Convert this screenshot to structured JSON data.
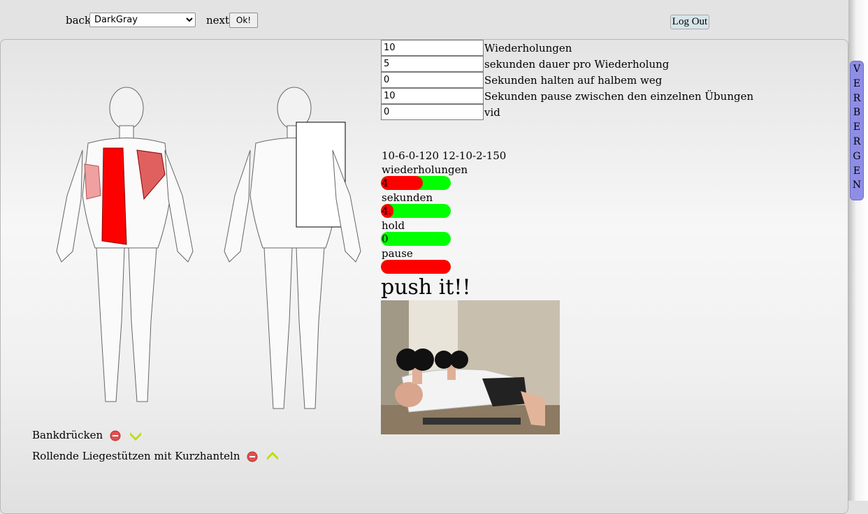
{
  "nav": {
    "back_label": "back",
    "theme_selected": "DarkGray",
    "next_label": "next",
    "ok_label": "Ok!",
    "logout_label": "Log Out"
  },
  "settings": [
    {
      "value": "10",
      "label": " Wiederholungen"
    },
    {
      "value": "5",
      "label": "sekunden dauer pro Wiederholung"
    },
    {
      "value": "0",
      "label": "Sekunden halten auf halbem weg"
    },
    {
      "value": "10",
      "label": "Sekunden pause zwischen den einzelnen Übungen"
    },
    {
      "value": "0",
      "label": "vid"
    }
  ],
  "program": {
    "code": "10-6-0-120 12-10-2-150"
  },
  "bars": [
    {
      "label": "wiederholungen",
      "value": "4",
      "fraction": 0.6
    },
    {
      "label": "sekunden",
      "value": "4.",
      "fraction": 0.18
    },
    {
      "label": "hold",
      "value": "0",
      "fraction": 0.0
    },
    {
      "label": "pause",
      "value": "",
      "fraction": 1.0
    }
  ],
  "status": {
    "message": "push it!!"
  },
  "exercises": [
    {
      "name": "Bankdrücken",
      "arrow": "chevron-down-icon"
    },
    {
      "name": "Rollende Liegestützen mit Kurzhanteln",
      "arrow": "chevron-up-icon"
    }
  ],
  "sidebar_tab": {
    "letters": [
      "V",
      "E",
      "R",
      "B",
      "E",
      "R",
      "G",
      "E",
      "N"
    ]
  },
  "colors": {
    "bar_track": "#00ff00",
    "bar_fill": "#ff0000",
    "tab_bg": "#8e8ee6",
    "chevron": "#b8e000",
    "remove_icon": "#e05050",
    "muscle_highlight": "#ff0000"
  }
}
